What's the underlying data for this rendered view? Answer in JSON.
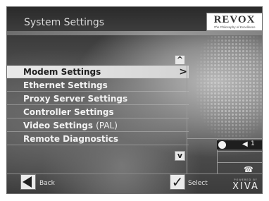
{
  "header": {
    "title": "System Settings",
    "brand": "REVOX",
    "brand_tagline": "The Philosophy of Excellence"
  },
  "menu": {
    "items": [
      {
        "label": "Modem Settings",
        "selected": true
      },
      {
        "label": "Ethernet Settings",
        "selected": false
      },
      {
        "label": "Proxy Server Settings",
        "selected": false
      },
      {
        "label": "Controller Settings",
        "selected": false
      },
      {
        "label": "Video Settings",
        "suffix": "(PAL)",
        "selected": false
      },
      {
        "label": "Remote Diagnostics",
        "selected": false
      }
    ],
    "scroll_up_glyph": "^",
    "scroll_down_glyph": "v",
    "selected_arrow_glyph": ">"
  },
  "status_panel": {
    "indicator_icon": "circle-icon",
    "volume_icon": "speaker-icon",
    "volume_level": "1",
    "phone_icon": "phone-icon"
  },
  "footer": {
    "back_label": "Back",
    "select_label": "Select",
    "select_glyph": "✓",
    "powered_by": "POWERED BY",
    "powered_brand": "XIVA"
  },
  "colors": {
    "background": "#3a3a3a",
    "selected_row": "#e2e2e2",
    "text": "#f2f2f2",
    "selected_text": "#1e1e1e"
  }
}
